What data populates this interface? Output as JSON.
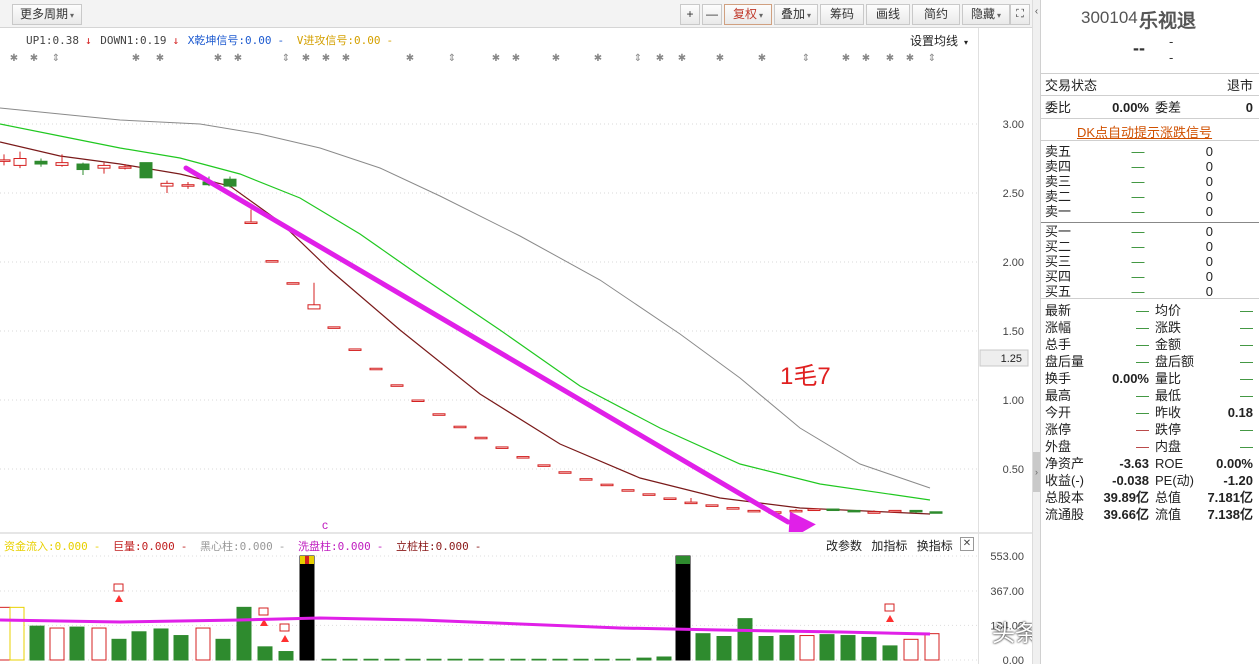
{
  "toolbar": {
    "period_label": "更多周期",
    "buttons": [
      "+",
      "—",
      "复权",
      "叠加",
      "筹码",
      "画线",
      "简约",
      "隐藏"
    ]
  },
  "indicator_legend": {
    "up1": "UP1:0.38",
    "down1": "DOWN1:0.19",
    "x_signal": "X乾坤信号:0.00",
    "v_signal": "V进攻信号:0.00",
    "settings": "设置均线"
  },
  "main_chart": {
    "price_axis": [
      "3.00",
      "2.50",
      "2.00",
      "1.50",
      "1.00",
      "0.50"
    ],
    "current_price_tag": "1.25",
    "annotation": "1毛7",
    "marker_top": "c"
  },
  "volume_legend": {
    "capital_inflow": "资金流入:0.000",
    "huge_volume": "巨量:0.000",
    "black_core": "黑心柱:0.000",
    "wash_column": "洗盘柱:0.000",
    "pile_column": "立桩柱:0.000",
    "change_params": "改参数",
    "add_indicator": "加指标",
    "swap_indicator": "换指标",
    "close": "✕"
  },
  "volume_axis": [
    "553.00",
    "367.00",
    "184.00",
    "0.00"
  ],
  "watermark": "头条 @朱超MSc",
  "quote": {
    "code": "300104",
    "name": "乐视退",
    "price": "--",
    "change": "-",
    "change_pct": "-",
    "status_label": "交易状态",
    "status_value": "退市",
    "ratio_label": "委比",
    "ratio_value": "0.00%",
    "diff_label": "委差",
    "diff_value": "0",
    "dk_link": "DK点自动提示涨跌信号",
    "asks": [
      {
        "label": "卖五",
        "price": "—",
        "vol": "0"
      },
      {
        "label": "卖四",
        "price": "—",
        "vol": "0"
      },
      {
        "label": "卖三",
        "price": "—",
        "vol": "0"
      },
      {
        "label": "卖二",
        "price": "—",
        "vol": "0"
      },
      {
        "label": "卖一",
        "price": "—",
        "vol": "0"
      }
    ],
    "bids": [
      {
        "label": "买一",
        "price": "—",
        "vol": "0"
      },
      {
        "label": "买二",
        "price": "—",
        "vol": "0"
      },
      {
        "label": "买三",
        "price": "—",
        "vol": "0"
      },
      {
        "label": "买四",
        "price": "—",
        "vol": "0"
      },
      {
        "label": "买五",
        "price": "—",
        "vol": "0"
      }
    ],
    "stats": [
      {
        "k1": "最新",
        "v1": "—",
        "k2": "均价",
        "v2": "—"
      },
      {
        "k1": "涨幅",
        "v1": "—",
        "k2": "涨跌",
        "v2": "—"
      },
      {
        "k1": "总手",
        "v1": "—",
        "k2": "金额",
        "v2": "—"
      },
      {
        "k1": "盘后量",
        "v1": "—",
        "k2": "盘后额",
        "v2": "—"
      },
      {
        "k1": "换手",
        "v1": "0.00%",
        "k2": "量比",
        "v2": "—"
      },
      {
        "k1": "最高",
        "v1": "—",
        "k2": "最低",
        "v2": "—"
      },
      {
        "k1": "今开",
        "v1": "—",
        "k2": "昨收",
        "v2": "0.18"
      },
      {
        "k1": "涨停",
        "v1": "—",
        "k2": "跌停",
        "v2": "—"
      },
      {
        "k1": "外盘",
        "v1": "—",
        "k2": "内盘",
        "v2": "—"
      },
      {
        "k1": "净资产",
        "v1": "-3.63",
        "k2": "ROE",
        "v2": "0.00%"
      },
      {
        "k1": "收益(-)",
        "v1": "-0.038",
        "k2": "PE(动)",
        "v2": "-1.20"
      },
      {
        "k1": "总股本",
        "v1": "39.89亿",
        "k2": "总值",
        "v2": "7.181亿"
      },
      {
        "k1": "流通股",
        "v1": "39.66亿",
        "k2": "流值",
        "v2": "7.138亿"
      }
    ]
  },
  "colors": {
    "up": "#d42020",
    "down": "#2e8b2e",
    "ma_fast": "#7a1a1a",
    "ma_mid": "#20c820",
    "ma_slow": "#8a8a8a",
    "trend_arrow": "#e020e8",
    "annotation": "#e02020"
  }
}
